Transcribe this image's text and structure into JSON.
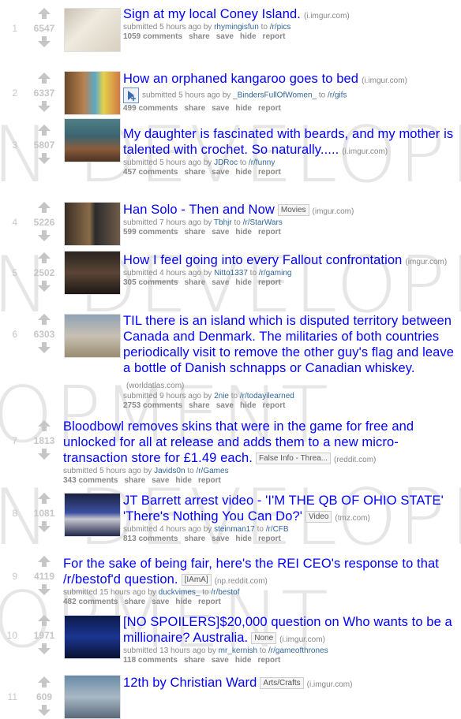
{
  "watermark": [
    "N DEVELOPMEN",
    "N DEVELOPMEN",
    "OPMENT",
    "N DEVELOPMEN",
    "OPMENT"
  ],
  "posts": [
    {
      "rank": "1",
      "score": "6547",
      "title": "Sign at my local Coney Island.",
      "flair": "",
      "domain": "(i.imgur.com)",
      "submitted": "submitted 5 hours ago by",
      "user": "rhymingisfun",
      "to": "to",
      "sub": "/r/pics",
      "comments": "1059 comments",
      "share": "share",
      "save": "save",
      "hide": "hide",
      "report": "report"
    },
    {
      "rank": "2",
      "score": "6337",
      "title": "How an orphaned kangaroo goes to bed",
      "flair": "",
      "domain": "(i.imgur.com)",
      "submitted": "submitted 5 hours ago by",
      "user": "_BindersFullOfWomen_",
      "to": "to",
      "sub": "/r/gifs",
      "comments": "499 comments",
      "share": "share",
      "save": "save",
      "hide": "hide",
      "report": "report"
    },
    {
      "rank": "3",
      "score": "5807",
      "title": "My daughter is fascinated with beards, and my mother is talented with crochet. So naturally.....",
      "flair": "",
      "domain": "(i.imgur.com)",
      "submitted": "submitted 5 hours ago by",
      "user": "JDRoc",
      "to": "to",
      "sub": "/r/funny",
      "comments": "457 comments",
      "share": "share",
      "save": "save",
      "hide": "hide",
      "report": "report"
    },
    {
      "rank": "4",
      "score": "5226",
      "title": "Han Solo - Then and Now",
      "flair": "Movies",
      "domain": "(imgur.com)",
      "submitted": "submitted 7 hours ago by",
      "user": "Tbhjr",
      "to": "to",
      "sub": "/r/StarWars",
      "comments": "599 comments",
      "share": "share",
      "save": "save",
      "hide": "hide",
      "report": "report"
    },
    {
      "rank": "5",
      "score": "2502",
      "title": "How I feel going into every Fallout confrontation",
      "flair": "",
      "domain": "(imgur.com)",
      "submitted": "submitted 4 hours ago by",
      "user": "Nitto1337",
      "to": "to",
      "sub": "/r/gaming",
      "comments": "305 comments",
      "share": "share",
      "save": "save",
      "hide": "hide",
      "report": "report"
    },
    {
      "rank": "6",
      "score": "6303",
      "title": "TIL there is an island which is disputed territory between Canada and Denmark. The militaries of both countries periodically visit to remove the other guy's flag and leave a bottle of Danish schnapps or Canadian whiskey.",
      "flair": "",
      "domain": "(worldatlas.com)",
      "submitted": "submitted 9 hours ago by",
      "user": "2nie",
      "to": "to",
      "sub": "/r/todayilearned",
      "comments": "2753 comments",
      "share": "share",
      "save": "save",
      "hide": "hide",
      "report": "report"
    },
    {
      "rank": "7",
      "score": "1813",
      "title": "Bloodbowl removes skins that were in the game for free and unlocked for all at release and adds them to a new micro-transaction store for £1.49 each.",
      "flair": "False Info - Threa...",
      "domain": "(reddit.com)",
      "submitted": "submitted 5 hours ago by",
      "user": "Javids0n",
      "to": "to",
      "sub": "/r/Games",
      "comments": "343 comments",
      "share": "share",
      "save": "save",
      "hide": "hide",
      "report": "report"
    },
    {
      "rank": "8",
      "score": "1081",
      "title": "JT Barrett arrest video - 'I'M THE QB OF OHIO STATE' 'There's Nothing You Can Do?'",
      "flair": "Video",
      "domain": "(tmz.com)",
      "submitted": "submitted 4 hours ago by",
      "user": "steinman17",
      "to": "to",
      "sub": "/r/CFB",
      "comments": "813 comments",
      "share": "share",
      "save": "save",
      "hide": "hide",
      "report": "report"
    },
    {
      "rank": "9",
      "score": "4119",
      "title": "For the sake of being fair, here's the REI CEO's response to that /r/bestof'd question.",
      "flair": "[IAmA]",
      "domain": "(np.reddit.com)",
      "submitted": "submitted 15 hours ago by",
      "user": "duckvimes_",
      "to": "to",
      "sub": "/r/bestof",
      "comments": "482 comments",
      "share": "share",
      "save": "save",
      "hide": "hide",
      "report": "report"
    },
    {
      "rank": "10",
      "score": "1971",
      "title": "[NO SPOILERS]$20,000 question on Who wants to be a millionaire? Australia.",
      "flair": "None",
      "domain": "(i.imgur.com)",
      "submitted": "submitted 13 hours ago by",
      "user": "mr_kernish",
      "to": "to",
      "sub": "/r/gameofthrones",
      "comments": "118 comments",
      "share": "share",
      "save": "save",
      "hide": "hide",
      "report": "report"
    },
    {
      "rank": "11",
      "score": "609",
      "title": "12th by Christian Ward",
      "flair": "Arts/Crafts",
      "domain": "(i.imgur.com)",
      "submitted": "",
      "user": "",
      "to": "",
      "sub": "",
      "comments": "",
      "share": "",
      "save": "",
      "hide": "",
      "report": ""
    }
  ]
}
